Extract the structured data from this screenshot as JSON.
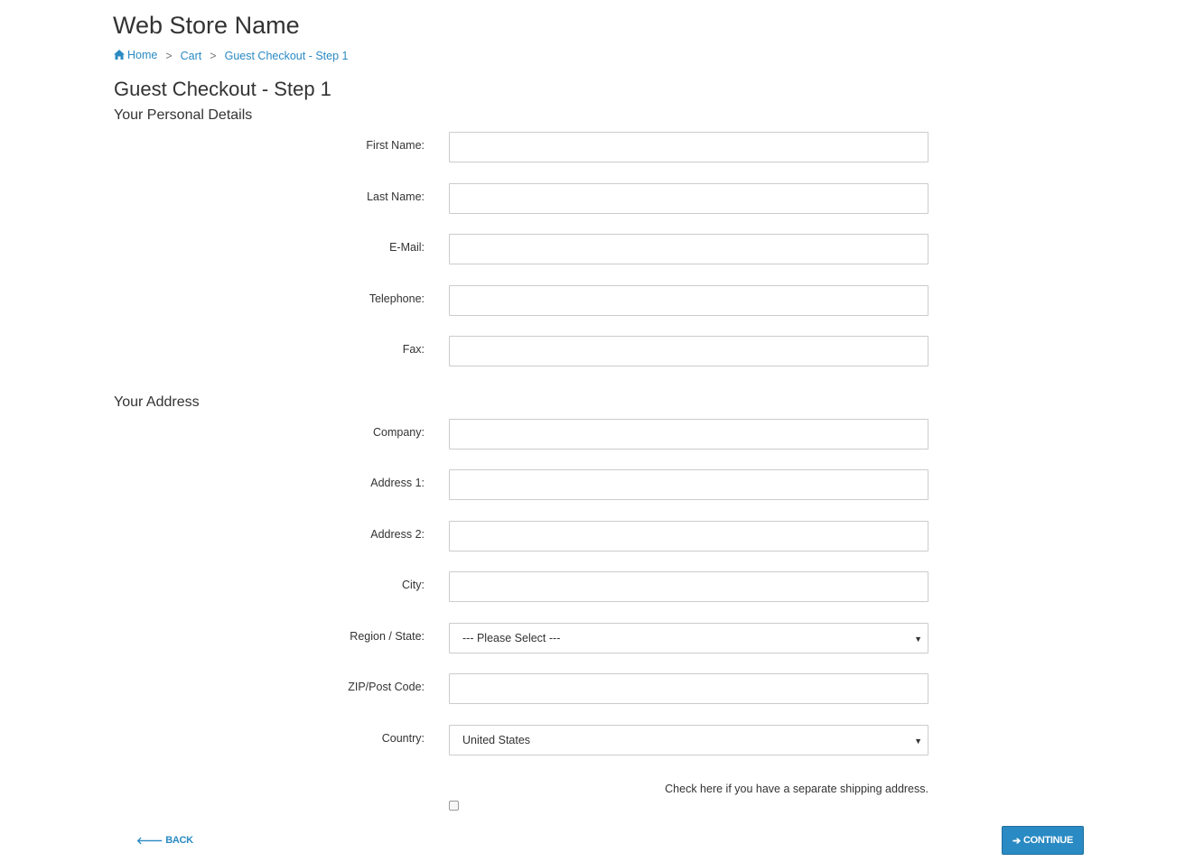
{
  "store": {
    "name": "Web Store Name"
  },
  "breadcrumb": {
    "home": "Home",
    "separator": ">",
    "cart": "Cart",
    "current": "Guest Checkout - Step 1"
  },
  "page": {
    "title": "Guest Checkout - Step 1"
  },
  "personal": {
    "title": "Your Personal Details",
    "first_name": {
      "label": "First Name:",
      "value": ""
    },
    "last_name": {
      "label": "Last Name:",
      "value": ""
    },
    "email": {
      "label": "E-Mail:",
      "value": ""
    },
    "telephone": {
      "label": "Telephone:",
      "value": ""
    },
    "fax": {
      "label": "Fax:",
      "value": ""
    }
  },
  "address": {
    "title": "Your Address",
    "company": {
      "label": "Company:",
      "value": ""
    },
    "address1": {
      "label": "Address 1:",
      "value": ""
    },
    "address2": {
      "label": "Address 2:",
      "value": ""
    },
    "city": {
      "label": "City:",
      "value": ""
    },
    "region": {
      "label": "Region / State:",
      "selected": "--- Please Select ---"
    },
    "zip": {
      "label": "ZIP/Post Code:",
      "value": ""
    },
    "country": {
      "label": "Country:",
      "selected": "United States"
    }
  },
  "shipping": {
    "note": "Check here if you have a separate shipping address.",
    "checked": false
  },
  "actions": {
    "back": "BACK",
    "continue": "CONTINUE"
  },
  "colors": {
    "link": "#2a8ac3",
    "button": "#2a8ac3",
    "border": "#cccccc"
  },
  "icons": {
    "home": "home-icon",
    "back": "arrow-left-icon",
    "continue": "arrow-right-icon",
    "select": "caret-down-icon"
  }
}
